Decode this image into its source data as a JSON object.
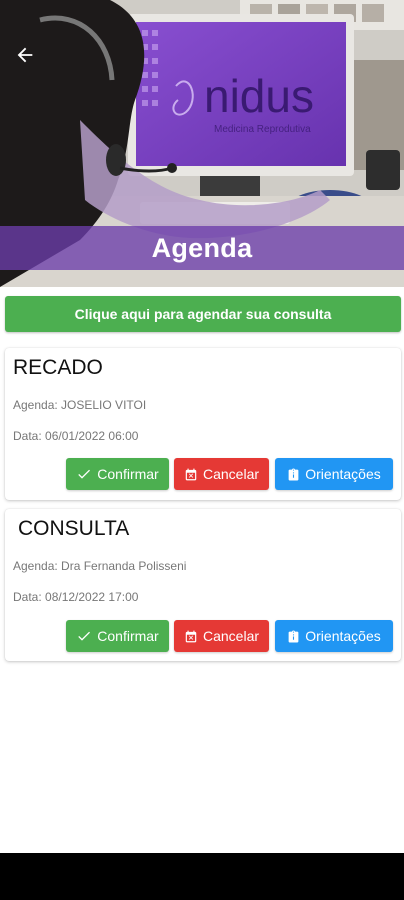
{
  "header": {
    "title": "Agenda",
    "banner_logo_text": "nidus",
    "banner_logo_subtext": "Medicina Reprodutiva"
  },
  "schedule_button": {
    "label": "Clique aqui para agendar sua consulta"
  },
  "appointments": [
    {
      "type": "RECADO",
      "agenda": "Agenda: JOSELIO VITOI",
      "date": "Data: 06/01/2022 06:00",
      "confirm_label": "Confirmar",
      "cancel_label": "Cancelar",
      "info_label": "Orientações"
    },
    {
      "type": "CONSULTA",
      "agenda": "Agenda: Dra Fernanda Polisseni",
      "date": "Data: 08/12/2022 17:00",
      "confirm_label": "Confirmar",
      "cancel_label": "Cancelar",
      "info_label": "Orientações"
    }
  ],
  "colors": {
    "confirm": "#4caf50",
    "cancel": "#e53935",
    "info": "#2196f3",
    "title_band": "#6c3eaa"
  },
  "icons": {
    "back": "arrow-left-icon",
    "confirm": "check-icon",
    "cancel": "calendar-x-icon",
    "info": "clipboard-icon"
  }
}
